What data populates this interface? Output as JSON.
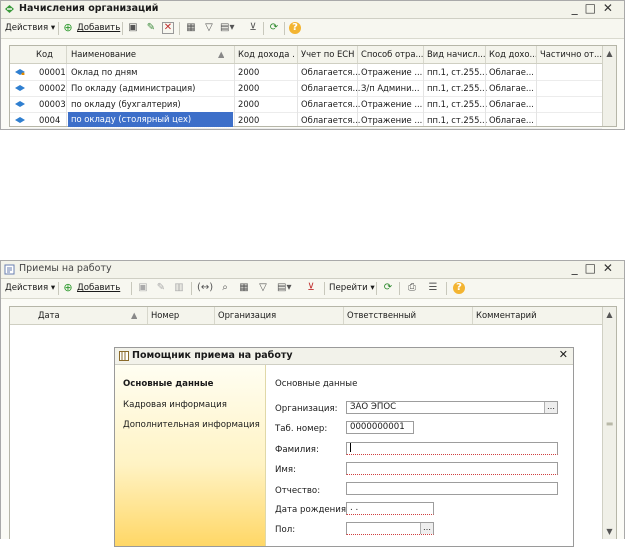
{
  "win1": {
    "title": "Начисления организаций",
    "toolbar": {
      "actions": "Действия",
      "add": "Добавить"
    },
    "columns": [
      "Код",
      "Наименование",
      "Код дохода ...",
      "Учет по ЕСН",
      "Способ отра...",
      "Вид начисл...",
      "Код дохо...",
      "Частично от..."
    ],
    "rows": [
      {
        "code": "00001",
        "name": "Оклад по дням",
        "income": "2000",
        "esn": "Облагается...",
        "method": "Отражение ...",
        "kind": "пп.1, ст.255...",
        "code2": "Облагае..."
      },
      {
        "code": "00002",
        "name": "По окладу (администрация)",
        "income": "2000",
        "esn": "Облагается...",
        "method": "З/п Админи...",
        "kind": "пп.1, ст.255...",
        "code2": "Облагае..."
      },
      {
        "code": "00003",
        "name": "по окладу (бухгалтерия)",
        "income": "2000",
        "esn": "Облагается...",
        "method": "Отражение ...",
        "kind": "пп.1, ст.255...",
        "code2": "Облагае..."
      },
      {
        "code": "0004",
        "name": "по окладу (столярный цех)",
        "income": "2000",
        "esn": "Облагается...",
        "method": "Отражение ...",
        "kind": "пп.1, ст.255...",
        "code2": "Облагае..."
      }
    ]
  },
  "win2": {
    "title": "Приемы на работу",
    "toolbar": {
      "actions": "Действия",
      "add": "Добавить",
      "goto": "Перейти"
    },
    "columns": [
      "Дата",
      "Номер",
      "Организация",
      "Ответственный",
      "Комментарий"
    ]
  },
  "dialog": {
    "title": "Помощник приема на работу",
    "nav": [
      "Основные данные",
      "Кадровая информация",
      "Дополнительная информация"
    ],
    "section": "Основные данные",
    "labels": {
      "org": "Организация:",
      "tab": "Таб. номер:",
      "surname": "Фамилия:",
      "name": "Имя:",
      "patronymic": "Отчество:",
      "birth": "Дата рождения:",
      "gender": "Пол:"
    },
    "values": {
      "org": "ЗАО ЭПОС",
      "tab": "0000000001",
      "surname": "",
      "name": "",
      "patronymic": "",
      "birth": " .  .",
      "gender": ""
    }
  },
  "colors": {
    "selection": "#3d6fc9",
    "accent": "#2f7fd0"
  }
}
